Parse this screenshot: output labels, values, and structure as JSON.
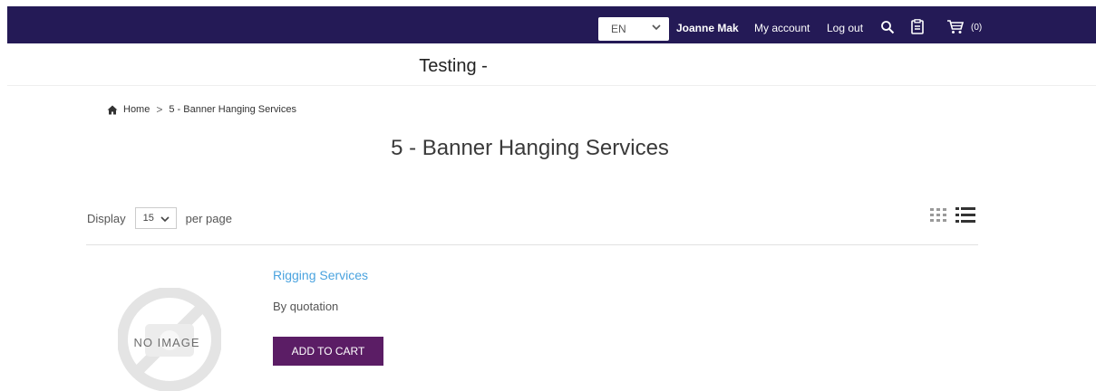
{
  "topbar": {
    "language": "EN",
    "user_name": "Joanne Mak",
    "my_account": "My account",
    "log_out": "Log out",
    "cart_count": "(0)",
    "icons": [
      "chevron-down-icon",
      "search-icon",
      "clipboard-icon",
      "cart-icon"
    ]
  },
  "site": {
    "title": "Testing -"
  },
  "breadcrumb": {
    "home": "Home",
    "separator": ">",
    "current": "5 - Banner Hanging Services"
  },
  "category": {
    "title": "5 - Banner Hanging Services"
  },
  "toolbar": {
    "display_label": "Display",
    "per_page_value": "15",
    "per_page_suffix": "per page",
    "views": [
      "grid-view-icon",
      "list-view-icon"
    ]
  },
  "products": [
    {
      "image_placeholder": "NO IMAGE",
      "name": "Rigging Services",
      "price": "By quotation",
      "button": "ADD TO CART"
    }
  ],
  "colors": {
    "topbar_bg": "#241a56",
    "link": "#4aa3df",
    "button_bg": "#5b1d65"
  }
}
